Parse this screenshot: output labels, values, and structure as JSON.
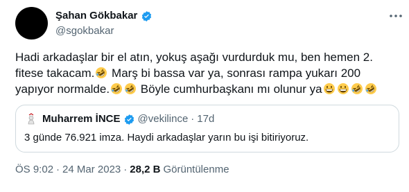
{
  "tweet": {
    "author": {
      "display_name": "Şahan Gökbakar",
      "handle": "@sgokbakar",
      "verified_icon": "verified-badge-icon",
      "avatar_color": "#000000"
    },
    "text_parts": [
      "Hadi arkadaşlar bir el atın, yokuş aşağı vurdurduk mu, ben hemen 2. fitese takacam.",
      " Marş bi bassa var ya, sonrası rampa yukarı 200 yapıyor normalde.",
      " Böyle cumhurbaşkanı mı olunur ya"
    ],
    "emoji_names": [
      "rolling-on-floor-laughing",
      "grinning-face"
    ],
    "quote": {
      "display_name": "Muharrem İNCE",
      "handle": "@vekilince",
      "separator": "·",
      "time": "17d",
      "text": "3 günde 76.921 imza. Haydi arkadaşlar yarın bu işi bitiriyoruz."
    },
    "meta": {
      "time": "ÖS 9:02",
      "separator": "·",
      "date": "24 Mar 2023",
      "separator2": "·",
      "views_count": "28,2 B",
      "views_label": "Görüntülenme"
    }
  },
  "colors": {
    "verified_blue": "#1d9bf0",
    "secondary_text": "#536471",
    "primary_text": "#0f1419",
    "border": "#cfd9de"
  }
}
